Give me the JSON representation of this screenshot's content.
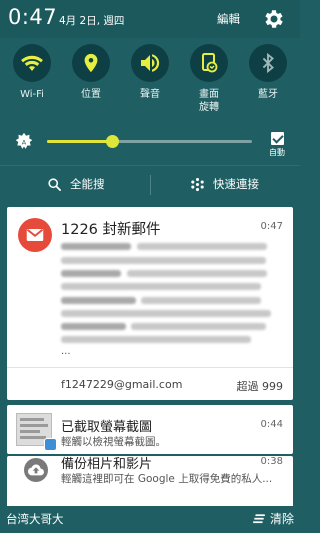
{
  "status": {
    "time": "0:47",
    "date": "4月 2日, 週四",
    "edit_label": "編輯"
  },
  "toggles": [
    {
      "label": "Wi-Fi",
      "icon": "wifi-icon"
    },
    {
      "label": "位置",
      "icon": "location-pin-icon"
    },
    {
      "label": "聲音",
      "icon": "volume-icon"
    },
    {
      "label": "畫面\n旋轉",
      "icon": "screen-rotation-icon"
    },
    {
      "label": "藍牙",
      "icon": "bluetooth-icon"
    }
  ],
  "brightness": {
    "level": 0.32,
    "auto_label": "自動",
    "auto_checked": true
  },
  "actions": {
    "search_label": "全能搜",
    "connect_label": "快速連接"
  },
  "notifications": {
    "gmail": {
      "title": "1226 封新郵件",
      "time": "0:47",
      "ellipsis": "...",
      "account": "f1247229@gmail.com",
      "more": "超過 999"
    },
    "screenshot": {
      "title": "已截取螢幕截圖",
      "subtitle": "輕觸以檢視螢幕截圖。",
      "time": "0:44"
    },
    "backup": {
      "title": "備份相片和影片",
      "subtitle": "輕觸這裡即可在 Google 上取得免費的私人...",
      "time": "0:38"
    }
  },
  "bottom": {
    "carrier": "台湾大哥大",
    "clear_label": "清除"
  },
  "colors": {
    "panel_bg": "#1f5f63",
    "toggle_active": "#e8ee3f",
    "gmail_red": "#e64a3a"
  }
}
